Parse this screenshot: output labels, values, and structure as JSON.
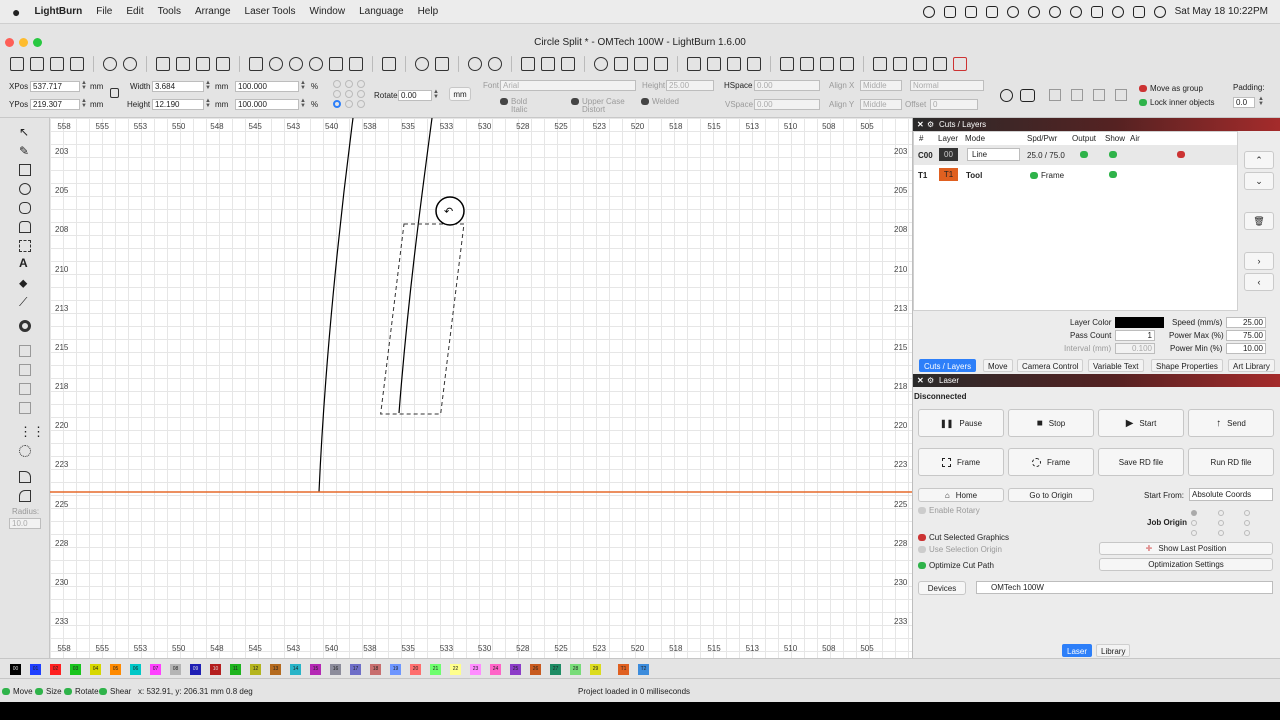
{
  "menubar": {
    "apple": "",
    "app": "LightBurn",
    "items": [
      "File",
      "Edit",
      "Tools",
      "Arrange",
      "Laser Tools",
      "Window",
      "Language",
      "Help"
    ],
    "clock": "Sat May 18  10:22PM"
  },
  "window": {
    "title": "Circle Split * - OMTech 100W - LightBurn 1.6.00"
  },
  "props": {
    "xpos_label": "XPos",
    "xpos": "537.717",
    "ypos_label": "YPos",
    "ypos": "219.307",
    "unit": "mm",
    "width_label": "Width",
    "width": "3.684",
    "height_label": "Height",
    "height": "12.190",
    "pct_w": "100.000",
    "pct_h": "100.000",
    "pct": "%",
    "rotate_label": "Rotate",
    "rotate": "0.00",
    "mm_btn": "mm",
    "font_label": "Font",
    "font": "Arial",
    "height2_label": "Height",
    "height2": "25.00",
    "hspace_label": "HSpace",
    "hspace": "0.00",
    "vspace_label": "VSpace",
    "vspace": "0.00",
    "alignx_label": "Align X",
    "alignx": "Middle",
    "aligny_label": "Align Y",
    "aligny": "Middle",
    "normal": "Normal",
    "offset_label": "Offset",
    "offset": "0",
    "bold": "Bold",
    "italic": "Italic",
    "upper": "Upper Case",
    "distort": "Distort",
    "welded": "Welded",
    "move_group": "Move as group",
    "lock_inner": "Lock inner objects",
    "padding_label": "Padding:",
    "padding": "0.0",
    "radius_label": "Radius:",
    "radius": "10.0"
  },
  "ruler": {
    "x": [
      "558",
      "555",
      "553",
      "550",
      "548",
      "545",
      "543",
      "540",
      "538",
      "535",
      "533",
      "530",
      "528",
      "525",
      "523",
      "520",
      "518",
      "515",
      "513",
      "510",
      "508",
      "505"
    ],
    "y": [
      "203",
      "205",
      "208",
      "210",
      "213",
      "215",
      "218",
      "220",
      "223",
      "225",
      "228",
      "230",
      "233"
    ]
  },
  "cuts": {
    "panel_title": "Cuts / Layers",
    "headers": [
      "#",
      "Layer",
      "Mode",
      "Spd/Pwr",
      "Output",
      "Show",
      "Air"
    ],
    "rows": [
      {
        "num": "C00",
        "layer": "00",
        "mode": "Line",
        "spd": "25.0 / 75.0"
      },
      {
        "num": "T1",
        "layer": "T1",
        "mode": "Tool",
        "spd": "Frame"
      }
    ],
    "layer_color": "Layer Color",
    "pass_count": "Pass Count",
    "pass_val": "1",
    "interval": "Interval (mm)",
    "interval_val": "0.100",
    "speed_label": "Speed (mm/s)",
    "speed": "25.00",
    "pmax_label": "Power Max (%)",
    "pmax": "75.00",
    "pmin_label": "Power Min (%)",
    "pmin": "10.00"
  },
  "tabs": [
    "Cuts / Layers",
    "Move",
    "Camera Control",
    "Variable Text",
    "Shape Properties",
    "Art Library"
  ],
  "laser": {
    "panel_title": "Laser",
    "status": "Disconnected",
    "pause": "Pause",
    "stop": "Stop",
    "start": "Start",
    "send": "Send",
    "frame1": "Frame",
    "frame2": "Frame",
    "save_rd": "Save RD file",
    "run_rd": "Run RD file",
    "home": "Home",
    "goto_origin": "Go to Origin",
    "start_from_label": "Start From:",
    "start_from": "Absolute Coords",
    "enable_rotary": "Enable Rotary",
    "job_origin": "Job Origin",
    "cut_selected": "Cut Selected Graphics",
    "use_sel_origin": "Use Selection Origin",
    "optimize": "Optimize Cut Path",
    "show_last": "Show Last Position",
    "opt_settings": "Optimization Settings",
    "devices": "Devices",
    "device": "OMTech 100W",
    "tab_laser": "Laser",
    "tab_library": "Library"
  },
  "palette": [
    "00",
    "01",
    "02",
    "03",
    "04",
    "05",
    "06",
    "07",
    "08",
    "09",
    "10",
    "11",
    "12",
    "13",
    "14",
    "15",
    "16",
    "17",
    "18",
    "19",
    "20",
    "21",
    "22",
    "23",
    "24",
    "25",
    "26",
    "27",
    "28",
    "29",
    "T1",
    "T2"
  ],
  "palette_colors": [
    "#000000",
    "#1f3fff",
    "#ff2020",
    "#19c51d",
    "#d7d700",
    "#ff8a00",
    "#00c8c8",
    "#ff40ff",
    "#b4b4b4",
    "#1e1eb4",
    "#b41e1e",
    "#1eb41e",
    "#b4b41e",
    "#b46a1e",
    "#28b4c8",
    "#b428b4",
    "#8c8c9b",
    "#6e6ec8",
    "#c86e6e",
    "#6e96ff",
    "#ff6e6e",
    "#6eff6e",
    "#ffff8c",
    "#ff8cff",
    "#ff64c8",
    "#8c3cc8",
    "#c85a1e",
    "#1e8c64",
    "#78dc78",
    "#dcdc1e",
    "#e06020",
    "#3c8cdc"
  ],
  "statusbar": {
    "move": "Move",
    "size": "Size",
    "rotate": "Rotate",
    "shear": "Shear",
    "coords": "x: 532.91, y: 206.31 mm  0.8 deg",
    "message": "Project loaded in 0 milliseconds"
  }
}
